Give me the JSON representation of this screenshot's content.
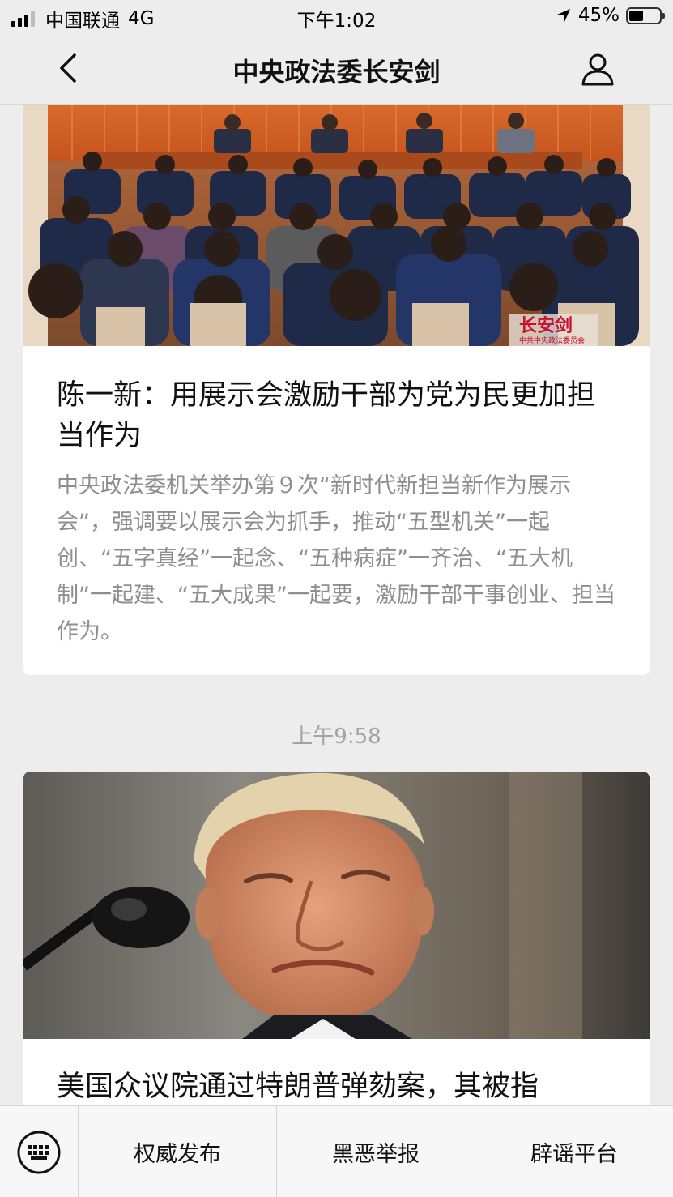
{
  "status_bar": {
    "carrier": "中国联通",
    "network": "4G",
    "time": "下午1:02",
    "battery": "45%"
  },
  "nav": {
    "title": "中央政法委长安剑",
    "back_icon": "chevron-left-icon",
    "profile_icon": "person-icon"
  },
  "feed": {
    "articles": [
      {
        "image_watermark": "长安剑",
        "image_watermark_sub": "中共中央政法委员会",
        "title": "陈一新：用展示会激励干部为党为民更加担当作为",
        "summary": "中央政法委机关举办第９次“新时代新担当新作为展示会”，强调要以展示会为抓手，推动“五型机关”一起创、“五字真经”一起念、“五种病症”一齐治、“五大机制”一起建、“五大成果”一起要，激励干部干事创业、担当作为。"
      },
      {
        "title": "美国众议院通过特朗普弹劾案，其被指"
      }
    ],
    "timestamp": "上午9:58"
  },
  "bottom_menu": {
    "keyboard_icon": "keyboard-icon",
    "items": [
      "权威发布",
      "黑恶举报",
      "辟谣平台"
    ]
  },
  "colors": {
    "background": "#ededed",
    "card": "#ffffff",
    "summary_text": "#8e8e8e",
    "timestamp_text": "#a3a3a3"
  }
}
